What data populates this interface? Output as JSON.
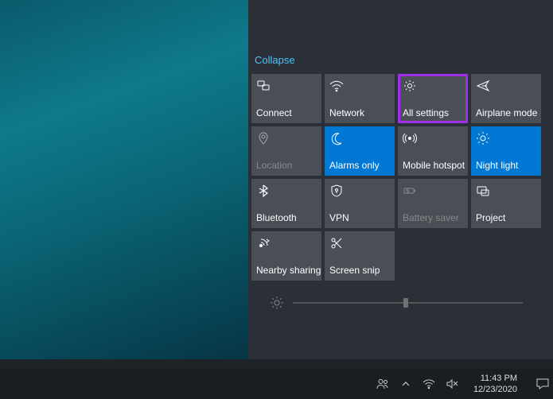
{
  "actionCenter": {
    "collapse": "Collapse",
    "tiles": [
      {
        "label": "Connect",
        "icon": "connect-icon",
        "state": "normal"
      },
      {
        "label": "Network",
        "icon": "network-icon",
        "state": "normal"
      },
      {
        "label": "All settings",
        "icon": "gear-icon",
        "state": "highlighted"
      },
      {
        "label": "Airplane mode",
        "icon": "airplane-icon",
        "state": "normal"
      },
      {
        "label": "Location",
        "icon": "location-icon",
        "state": "disabled"
      },
      {
        "label": "Alarms only",
        "icon": "moon-icon",
        "state": "active"
      },
      {
        "label": "Mobile hotspot",
        "icon": "hotspot-icon",
        "state": "normal"
      },
      {
        "label": "Night light",
        "icon": "nightlight-icon",
        "state": "active"
      },
      {
        "label": "Bluetooth",
        "icon": "bluetooth-icon",
        "state": "normal"
      },
      {
        "label": "VPN",
        "icon": "vpn-icon",
        "state": "normal"
      },
      {
        "label": "Battery saver",
        "icon": "battery-icon",
        "state": "disabled"
      },
      {
        "label": "Project",
        "icon": "project-icon",
        "state": "normal"
      },
      {
        "label": "Nearby sharing",
        "icon": "nearby-icon",
        "state": "normal"
      },
      {
        "label": "Screen snip",
        "icon": "snip-icon",
        "state": "normal"
      }
    ],
    "brightnessPercent": 50
  },
  "taskbar": {
    "time": "11:43 PM",
    "date": "12/23/2020"
  }
}
